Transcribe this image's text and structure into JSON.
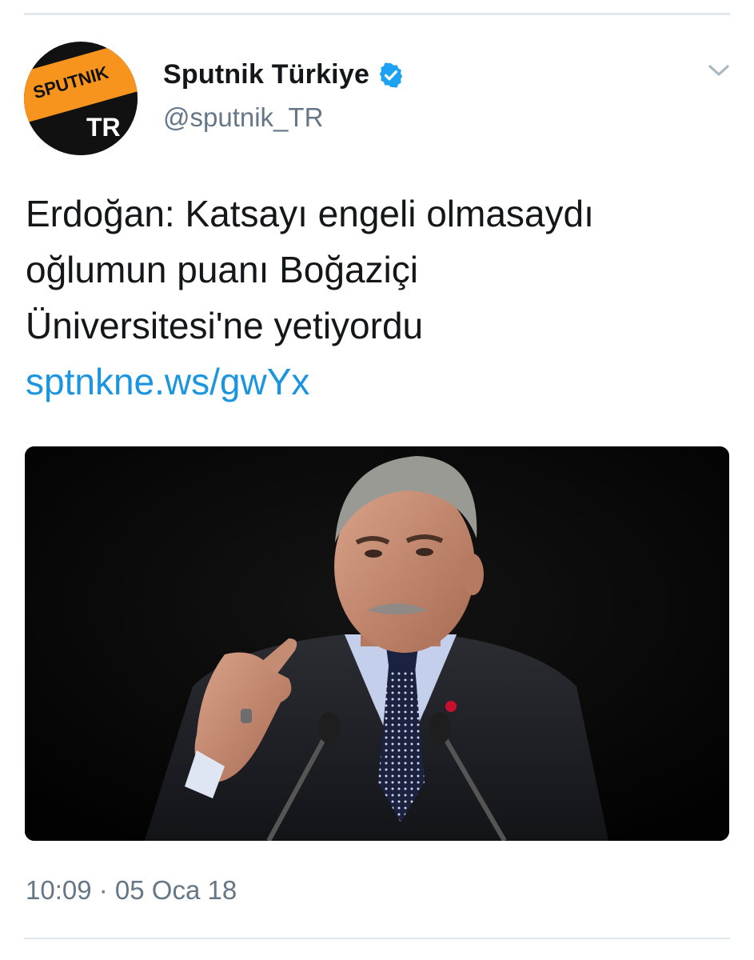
{
  "tweet": {
    "author": {
      "display_name": "Sputnik Türkiye",
      "handle": "@sputnik_TR",
      "verified": true,
      "avatar": {
        "icon": "sputnik-logo",
        "logo_text_top": "SPUTNIK",
        "logo_text_bottom": "TR",
        "colors": {
          "orange": "#f7941d",
          "black": "#111111"
        }
      }
    },
    "menu_icon": "chevron-down-icon",
    "text_lines": [
      "Erdoğan: Katsayı engeli olmasaydı",
      "oğlumun puanı Boğaziçi",
      "Üniversitesi'ne yetiyordu"
    ],
    "link": "sptnkne.ws/gwYx",
    "media_icon": "photo-of-speaker-at-podium",
    "timestamp": "10:09 · 05 Oca 18"
  },
  "colors": {
    "link": "#1b95e0",
    "secondary_text": "#657786",
    "verified_badge": "#1da1f2",
    "divider": "#e1e8ed"
  }
}
